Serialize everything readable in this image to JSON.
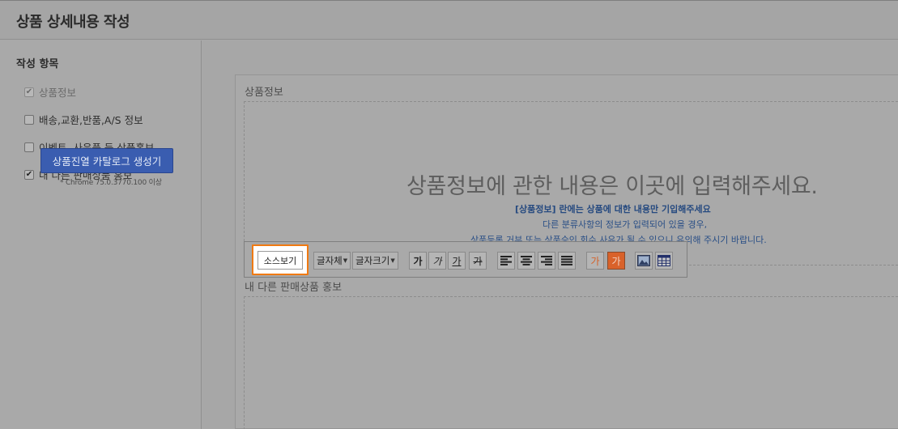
{
  "header": {
    "title": "상품 상세내용 작성"
  },
  "sidebar": {
    "title": "작성 항목",
    "items": [
      {
        "label": "상품정보",
        "checked": true,
        "disabled": true
      },
      {
        "label": "배송,교환,반품,A/S 정보",
        "checked": false,
        "disabled": false
      },
      {
        "label": "이벤트, 사은품 등 상품홍보",
        "checked": false,
        "disabled": false
      },
      {
        "label": "내 다른 판매상품 홍보",
        "checked": true,
        "disabled": false
      }
    ],
    "generator_button": "상품진열 카탈로그 생성기",
    "chrome_note": "* Chrome 75.0.3770.100 이상"
  },
  "editor": {
    "section1_label": "상품정보",
    "placeholder_main": "상품정보에 관한 내용은 이곳에 입력해주세요.",
    "placeholder_line1": "[상품정보] 란에는 상품에 대한 내용만 기입해주세요",
    "placeholder_line2": "다른 분류사항의 정보가 입력되어 있을 경우,",
    "placeholder_line3": "상품등록 거부 또는 상품승인 회수 사유가 될 수 있으니 유의해 주시기 바랍니다.",
    "section2_label": "내 다른 판매상품 홍보"
  },
  "toolbar": {
    "source_button": "소스보기",
    "font_family": "글자체",
    "font_size": "글자크기",
    "bold": "가",
    "italic": "가",
    "underline": "가",
    "strike": "가",
    "text_color": "가",
    "bg_color": "가",
    "icons": [
      "align-left-icon",
      "align-center-icon",
      "align-right-icon",
      "align-justify-icon",
      "image-icon",
      "table-icon"
    ],
    "colors": {
      "text_color_glyph": "#d4622a",
      "bg_color_fill": "#d9622a",
      "highlight_border": "#f07a12"
    }
  }
}
